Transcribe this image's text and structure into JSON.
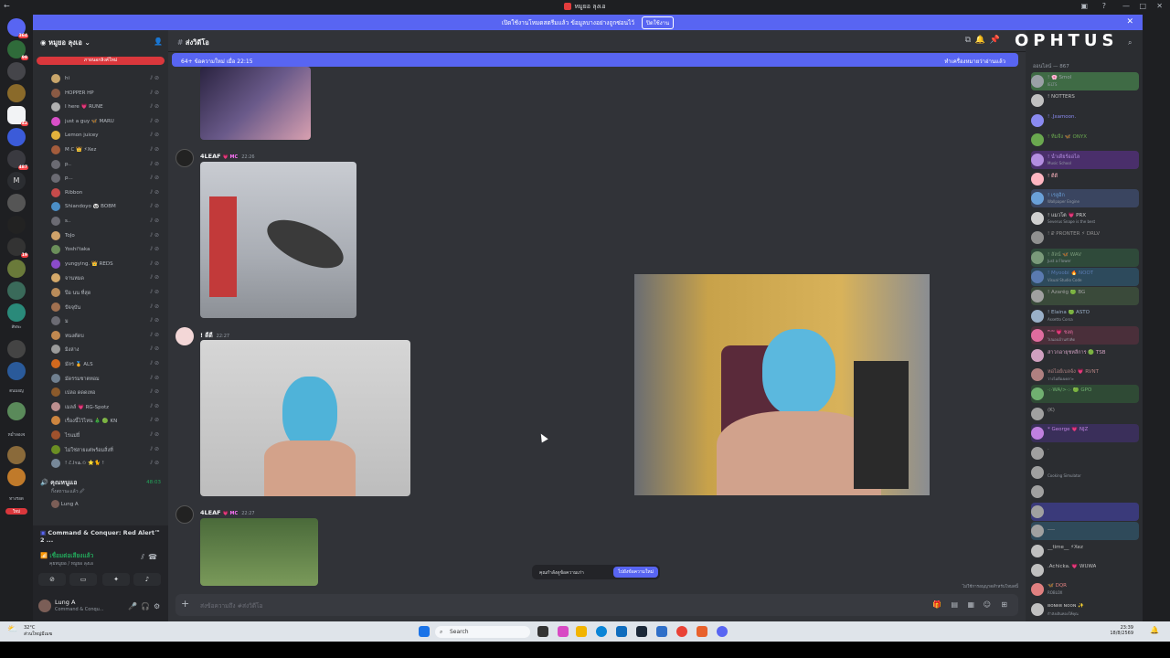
{
  "window": {
    "title": "หมูยอ ลุงเอ"
  },
  "banner": {
    "text": "เปิดใช้งานโหมดสตรีมแล้ว ข้อมูลบางอย่างถูกซ่อนไว้",
    "action": "ปิดใช้งาน"
  },
  "servers": {
    "badges": [
      "364",
      "99",
      "42",
      "487",
      "19"
    ],
    "labels": [
      "สัพพะ",
      "ตนมอญ",
      "หม่ำลองจ",
      "ทางรอด"
    ],
    "new_label": "ใหม่"
  },
  "sidebar": {
    "guild_name": "หมูยอ ลุงเอ",
    "red_button": "ภายนอกลิงค์ใหม่",
    "members": [
      {
        "name": "hi",
        "color": "#c9a66b"
      },
      {
        "name": "HOPPER HP",
        "color": "#8a5a44"
      },
      {
        "name": "I here 💗 RUNE",
        "color": "#b0b0b0"
      },
      {
        "name": "just a guy 🦋 MARU",
        "color": "#d94fc8"
      },
      {
        "name": "Lemon juicey",
        "color": "#e2b13c"
      },
      {
        "name": "M C 👑 ⚡Xez",
        "color": "#a35c3c"
      },
      {
        "name": "p..",
        "color": "#6b6b73"
      },
      {
        "name": "p...",
        "color": "#6b6b73"
      },
      {
        "name": "Ribbon",
        "color": "#c64b4b"
      },
      {
        "name": "Shiandoyo 🐼 BOBM",
        "color": "#4b8ec6"
      },
      {
        "name": "s..",
        "color": "#6b6b73"
      },
      {
        "name": "ToJo",
        "color": "#cfa26a"
      },
      {
        "name": "Yoshi'taka",
        "color": "#6b8f5a"
      },
      {
        "name": "yungying. 👑 REDS",
        "color": "#8a4bc9"
      },
      {
        "name": "จานหมด",
        "color": "#d4a96a"
      },
      {
        "name": "ป๊อ นน ที่สุด",
        "color": "#b88b5a"
      },
      {
        "name": "ปัจจุบัน",
        "color": "#a07050"
      },
      {
        "name": "ม",
        "color": "#6b6b73"
      },
      {
        "name": "หนงตัดบ",
        "color": "#c08850"
      },
      {
        "name": "มิงล่าง",
        "color": "#9b9b9b"
      },
      {
        "name": "มัลร 🏅 ALS",
        "color": "#d2691e"
      },
      {
        "name": "มัดรรมชาตทอม",
        "color": "#708090"
      },
      {
        "name": "เปลอ ดดดเทอ",
        "color": "#8b5a2b"
      },
      {
        "name": "เมลล์ 💗 RG-Spotz",
        "color": "#bc8f8f"
      },
      {
        "name": "เรื่องนี้ไว้ไหน 🎄 🟢 KN",
        "color": "#cd853f"
      },
      {
        "name": "ไรแม่ยี่",
        "color": "#a0522d"
      },
      {
        "name": "ไม่ใช่สายแต่พร้อมสิ่งที่",
        "color": "#6b8e23"
      },
      {
        "name": "! ℰ.lʏᴀ.✩ ⭐🐈 !",
        "color": "#778899"
      }
    ],
    "voice_channel": {
      "name": "คุณหนูแอ",
      "sub": "กิ้งสถานะแล้ว 🖉",
      "count": "48:03",
      "user": "Lung A"
    },
    "activity": "Command & Conquer: Red Alert™ 2 ...",
    "voice_connected": "เชื่อมต่อเสียงแล้ว",
    "voice_sub": "คุยหมูยอ / หมูยอ ลุงเอ",
    "user": {
      "name": "Lung A",
      "status": "Command & Conqu..."
    }
  },
  "chat": {
    "channel": "ส่งวิดีโอ",
    "new_messages": "64+ ข้อความใหม่ เมื่อ 22:15",
    "mark_read": "ทำเครื่องหมายว่าอ่านแล้ว",
    "messages": [
      {
        "user": "4LEAF",
        "tag": "💗 MC",
        "time": "22:26"
      },
      {
        "user": "! ดีดี",
        "tag": "",
        "time": "22:27"
      },
      {
        "user": "4LEAF",
        "tag": "💗 MC",
        "time": "22:27"
      }
    ],
    "toast_text": "คุณกำลังดูข้อความเก่า",
    "toast_button": "ไปยังข้อความใหม่",
    "composer_placeholder": "ส่งข้อความถึง #ส่งวิดีโอ",
    "hint": "ไม่ใช้การอนุญาตสำหรับโหมดนี้"
  },
  "memberlist": {
    "header": "ออนไลน์ — 867",
    "logo": "OPHTUS",
    "members": [
      {
        "name": "! 🌸 Smol",
        "sub": "IELTS",
        "color": "#9aa0a6",
        "bg": "#3f6b45"
      },
      {
        "name": "! NOTTERS",
        "sub": "",
        "color": "#c0c0c0",
        "bg": ""
      },
      {
        "name": "! .Jxamoon.",
        "sub": "",
        "color": "#8a8af0",
        "bg": ""
      },
      {
        "name": "! ทีมจีง 🦋 ONYX",
        "sub": "",
        "color": "#6aa84f",
        "bg": ""
      },
      {
        "name": "! น้ำเดียร์ออไล",
        "sub": "Music School",
        "color": "#b38de0",
        "bg": "#4a2f6b"
      },
      {
        "name": "! ดีดี",
        "sub": "",
        "color": "#ffb6c1",
        "bg": ""
      },
      {
        "name": "! เรลูอิก",
        "sub": "Wallpaper Engine",
        "color": "#6aa0d8",
        "bg": "#3a4560"
      },
      {
        "name": "! แมวโต 💗 PRX",
        "sub": "Severus Snape is the best",
        "color": "#d0d0d0",
        "bg": ""
      },
      {
        "name": "! ₽ PRONTER ⚡ DRLV",
        "sub": "",
        "color": "#909090",
        "bg": ""
      },
      {
        "name": "! ลัลน์ 🦋 WAV",
        "sub": "Just a Flower",
        "color": "#7a9a7a",
        "bg": "#2f4a3a"
      },
      {
        "name": "! Myoobi 🔥 NOOT",
        "sub": "Visual Studio Code",
        "color": "#5a7ab0",
        "bg": "#2d4a5c"
      },
      {
        "name": "! Azarêg 🟢 BG",
        "sub": "",
        "color": "#a0a0a0",
        "bg": "#3a4a3a"
      },
      {
        "name": "! Elaina 🟢 ASTO",
        "sub": "Assetto Corsa",
        "color": "#9ab0c8",
        "bg": ""
      },
      {
        "name": "ᴿᵁᴺ 💗 ชงตุ",
        "sub": "ไปนอนบ้านหัวคิด",
        "color": "#e06c9f",
        "bg": "#4a2f3a"
      },
      {
        "name": "สาวกอายุชหลีการ 🟢 TSB",
        "sub": "",
        "color": "#d0a0c0",
        "bg": ""
      },
      {
        "name": "หอไอย์เบลจ้ง 💗 RVNT",
        "sub": "วางไม่ต้องเคลาะ",
        "color": "#b08080",
        "bg": ""
      },
      {
        "name": "·:·WA/>·:· 🟢 GPO",
        "sub": "",
        "color": "#70b070",
        "bg": "#2f4a35"
      },
      {
        "name": "(K)",
        "sub": "",
        "color": "#a0a0a0",
        "bg": ""
      },
      {
        "name": "* George 💗 NJZ",
        "sub": "",
        "color": "#c080e0",
        "bg": "#3a2f5a"
      },
      {
        "name": "·",
        "sub": "",
        "color": "#a0a0a0",
        "bg": ""
      },
      {
        "name": "",
        "sub": "Cooking Simulator",
        "color": "#a0a0a0",
        "bg": ""
      },
      {
        "name": "",
        "sub": "",
        "color": "#a0a0a0",
        "bg": ""
      },
      {
        "name": "",
        "sub": "",
        "color": "#a0a0a0",
        "bg": "#3a3a7a"
      },
      {
        "name": "___",
        "sub": "",
        "color": "#a0a0a0",
        "bg": "#2f4a5a"
      },
      {
        "name": "__time__ ⚡Xez",
        "sub": "",
        "color": "#c0c0c0",
        "bg": ""
      },
      {
        "name": ".Achicka. 💗 WUWA",
        "sub": "",
        "color": "#c0c0c0",
        "bg": ""
      },
      {
        "name": "🦋 DQR",
        "sub": "ROBLOX",
        "color": "#e08080",
        "bg": ""
      },
      {
        "name": "ʙᴏɴᴇʙ ɴᴏᴏɴ ✨",
        "sub": "กำลังเดินทองให้คุณ",
        "color": "#c0c0c0",
        "bg": ""
      },
      {
        "name": "OJ9TheoHernandez",
        "sub": "",
        "color": "#c0c0c0",
        "bg": ""
      }
    ]
  },
  "taskbar": {
    "weather_temp": "32°C",
    "weather_desc": "ส่วนใหญ่มีเมฆ",
    "search": "Search",
    "time": "23:39",
    "date": "18/8/2569"
  }
}
